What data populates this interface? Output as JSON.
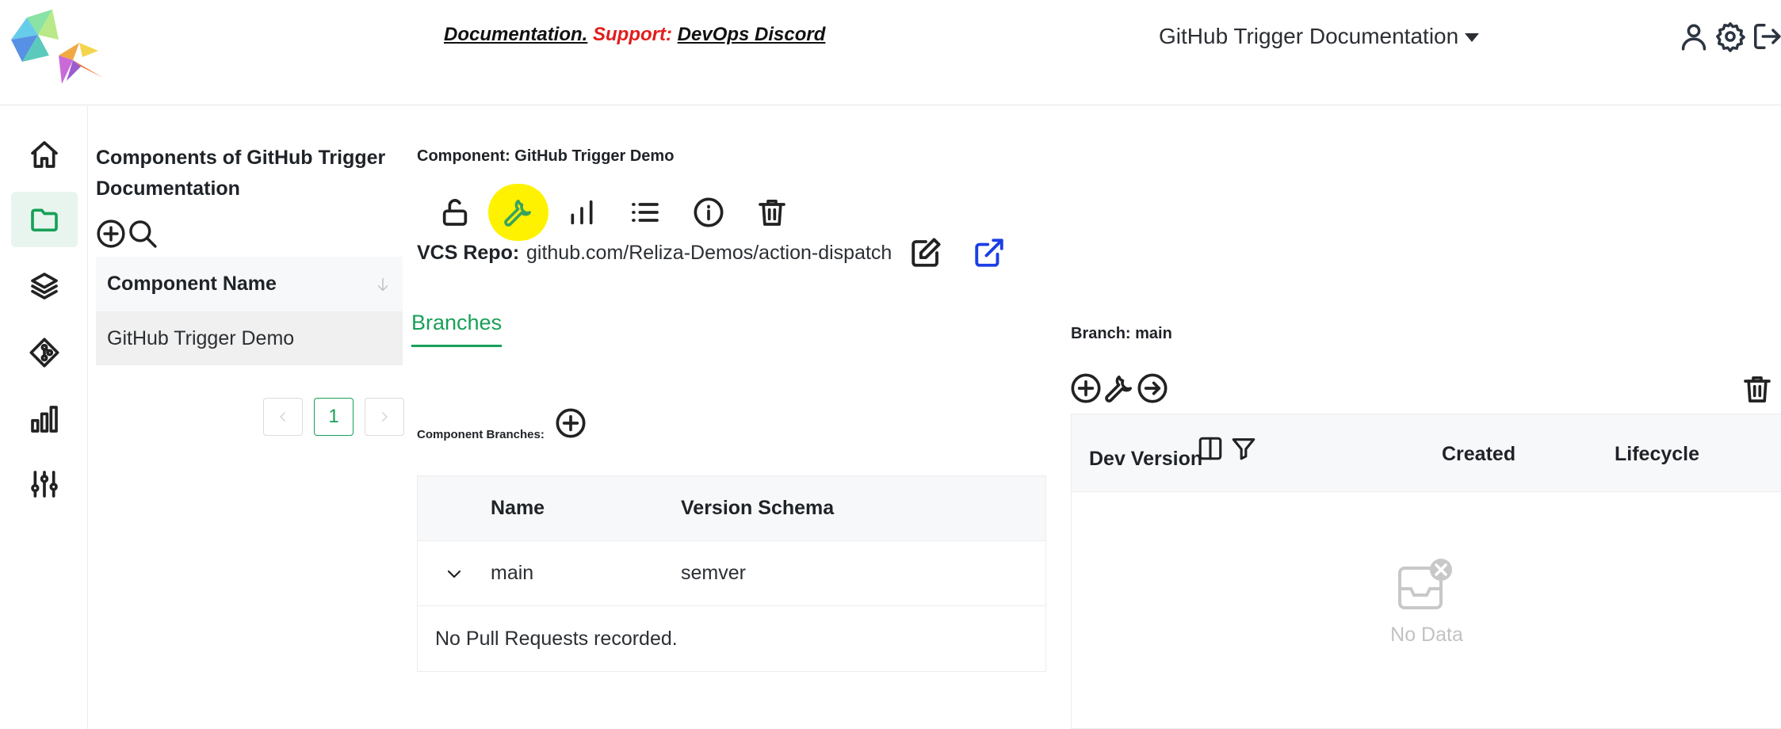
{
  "header": {
    "links": {
      "documentation": "Documentation.",
      "support_label": "Support:",
      "discord": "DevOps Discord"
    },
    "org_selector": "GitHub Trigger Documentation",
    "icons": [
      "user-icon",
      "gear-icon",
      "logout-icon"
    ]
  },
  "nav": {
    "items": [
      "home-icon",
      "folder-icon",
      "layers-icon",
      "git-icon",
      "bar-chart-icon",
      "sliders-icon"
    ],
    "active": "folder-icon",
    "accent": "#18a058"
  },
  "components_panel": {
    "title": "Components of GitHub Trigger Documentation",
    "table_header": "Component Name",
    "rows": [
      "GitHub Trigger Demo"
    ],
    "page": "1"
  },
  "component": {
    "header": "Component: GitHub Trigger Demo",
    "toolbar": [
      "unlock-icon",
      "wrench-icon",
      "bar-chart-icon",
      "list-icon",
      "info-icon",
      "trash-icon"
    ],
    "highlighted_tool": "wrench-icon",
    "vcs_label": "VCS Repo:",
    "vcs_value": "github.com/Reliza-Demos/action-dispatch",
    "tab": "Branches",
    "branches_label": "Component Branches:",
    "branch_table": {
      "columns": [
        "Name",
        "Version Schema"
      ],
      "rows": [
        {
          "name": "main",
          "schema": "semver"
        }
      ],
      "empty_text": "No Pull Requests recorded."
    }
  },
  "branch": {
    "title": "Branch: main",
    "columns": [
      "Dev Version",
      "Created",
      "Lifecycle"
    ],
    "empty_text": "No Data"
  }
}
